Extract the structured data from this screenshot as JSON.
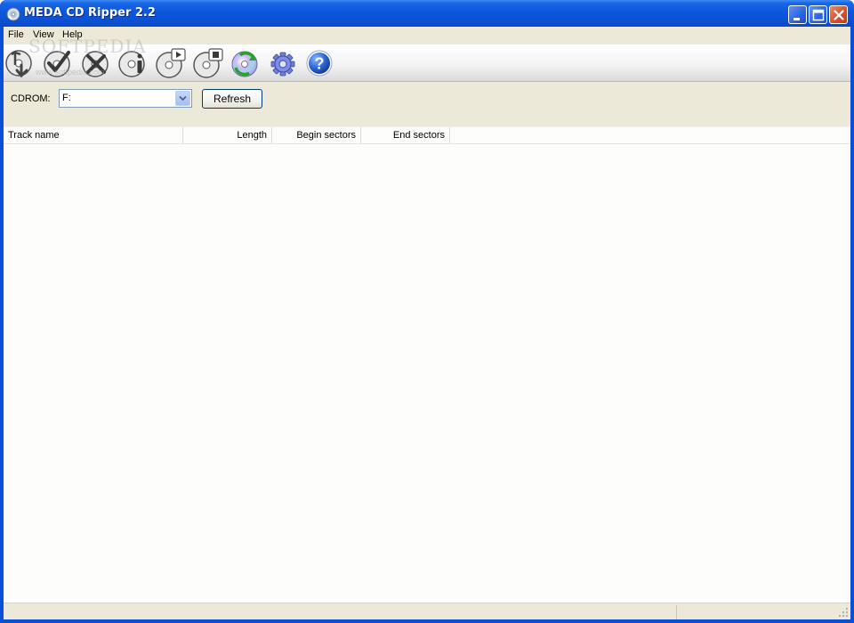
{
  "window": {
    "title": "MEDA CD Ripper 2.2",
    "icon": "cd-app-icon",
    "controls": [
      "minimize-icon",
      "maximize-icon",
      "close-icon"
    ],
    "watermark": "SOFTPEDIA",
    "watermark_url": "www.softpedia.com"
  },
  "menu": {
    "items": [
      {
        "label": "File"
      },
      {
        "label": "View"
      },
      {
        "label": "Help"
      }
    ]
  },
  "toolbar": {
    "buttons": [
      {
        "icon": "rip-cd-icon"
      },
      {
        "icon": "check-all-icon"
      },
      {
        "icon": "uncheck-all-icon"
      },
      {
        "icon": "cd-info-icon"
      },
      {
        "icon": "play-icon"
      },
      {
        "icon": "stop-icon"
      },
      {
        "icon": "eject-refresh-icon"
      },
      {
        "icon": "settings-gear-icon"
      },
      {
        "icon": "help-icon"
      }
    ]
  },
  "drive": {
    "label": "CDROM:",
    "selected": "F:",
    "refresh_label": "Refresh"
  },
  "tracklist": {
    "columns": [
      {
        "label": "Track name"
      },
      {
        "label": "Length"
      },
      {
        "label": "Begin sectors"
      },
      {
        "label": "End sectors"
      }
    ],
    "rows": []
  },
  "colors": {
    "titlebar": "#0b51d4",
    "face": "#ece9d8",
    "list_bg": "#fdfefc"
  }
}
